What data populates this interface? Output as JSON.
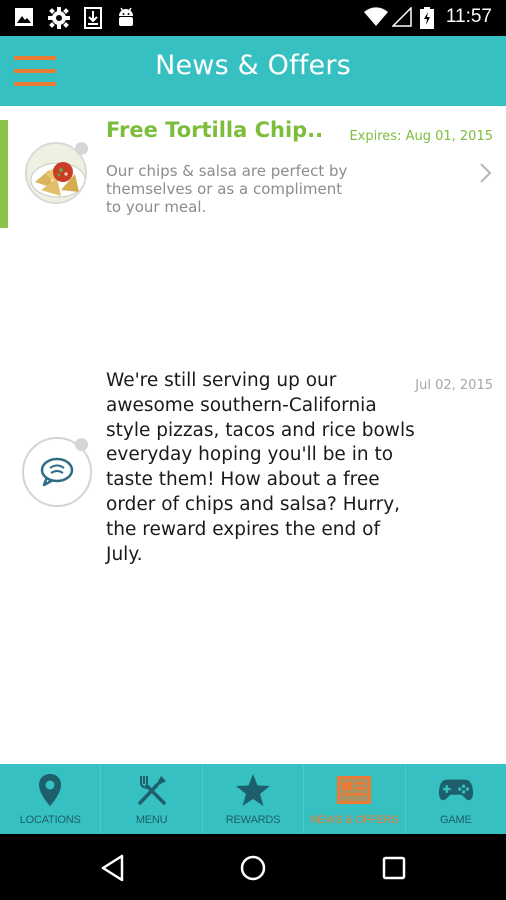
{
  "status_bar": {
    "time": "11:57",
    "icons": [
      "image-icon",
      "settings-gear-icon",
      "download-icon",
      "android-icon",
      "wifi-icon",
      "signal-icon",
      "battery-charging-icon"
    ]
  },
  "header": {
    "title": "News & Offers",
    "menu_icon": "hamburger-menu-icon"
  },
  "colors": {
    "header_bg": "#36c0c2",
    "accent_orange": "#e97b35",
    "accent_green": "#7cbd3b",
    "tab_icon": "#1d5f6a"
  },
  "messages": [
    {
      "title": "Free Tortilla Chip..",
      "expires": "Expires: Aug 01, 2015",
      "description": "Our chips & salsa are perfect by themselves or as a compliment to your meal.",
      "thumbnail": "chips-and-salsa-photo",
      "highlighted": true
    },
    {
      "body": "We're still serving up our awesome southern-California style pizzas, tacos and rice bowls everyday hoping you'll be in to taste them! How about a free order of chips and salsa? Hurry, the reward expires the end of July.",
      "date": "Jul 02, 2015",
      "icon": "chat-bubble-icon"
    }
  ],
  "tabs": [
    {
      "label": "LOCATIONS",
      "icon": "map-pin-icon",
      "active": false
    },
    {
      "label": "MENU",
      "icon": "fork-knife-icon",
      "active": false
    },
    {
      "label": "REWARDS",
      "icon": "star-icon",
      "active": false
    },
    {
      "label": "NEWS & OFFERS",
      "icon": "news-icon",
      "active": true
    },
    {
      "label": "GAME",
      "icon": "gamepad-icon",
      "active": false
    }
  ],
  "nav": {
    "back": "back-icon",
    "home": "home-icon",
    "recents": "recents-icon"
  }
}
